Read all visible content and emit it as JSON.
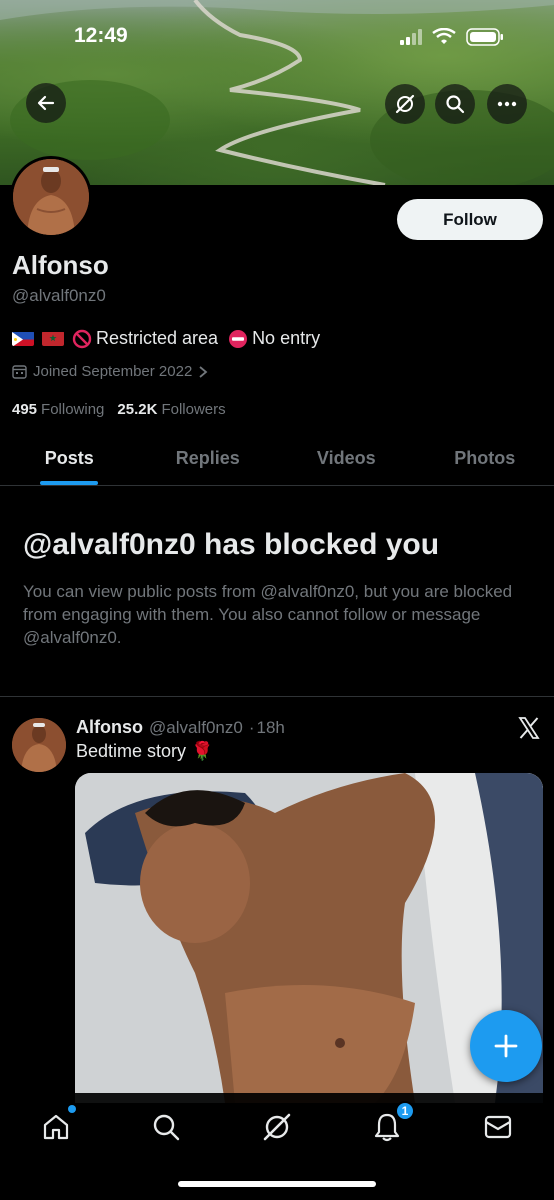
{
  "status_bar": {
    "time": "12:49"
  },
  "header": {
    "back_icon": "arrow-left-icon",
    "actions": [
      "grok-icon",
      "search-icon",
      "more-icon"
    ]
  },
  "profile": {
    "name": "Alfonso",
    "handle": "@alvalf0nz0",
    "bio": {
      "flags": [
        "philippines-flag",
        "morocco-flag"
      ],
      "text1": "Restricted area",
      "text2": "No entry"
    },
    "joined": "Joined September 2022",
    "following_count": "495",
    "following_label": "Following",
    "followers_count": "25.2K",
    "followers_label": "Followers",
    "follow_label": "Follow"
  },
  "tabs": [
    {
      "label": "Posts",
      "active": true
    },
    {
      "label": "Replies",
      "active": false
    },
    {
      "label": "Videos",
      "active": false
    },
    {
      "label": "Photos",
      "active": false
    }
  ],
  "blocked": {
    "title": "@alvalf0nz0 has blocked you",
    "body": "You can view public posts from @alvalf0nz0, but you are blocked from engaging with them. You also cannot follow or message @alvalf0nz0."
  },
  "post": {
    "name": "Alfonso",
    "handle": "@alvalf0nz0",
    "separator": "·",
    "time": "18h",
    "text": "Bedtime story 🌹"
  },
  "bottom_nav": {
    "items": [
      "home-icon",
      "search-icon",
      "grok-icon",
      "notifications-icon",
      "messages-icon"
    ],
    "notification_count": "1"
  },
  "colors": {
    "accent": "#1d9bf0",
    "text_secondary": "#71767b",
    "divider": "#2f3336"
  }
}
